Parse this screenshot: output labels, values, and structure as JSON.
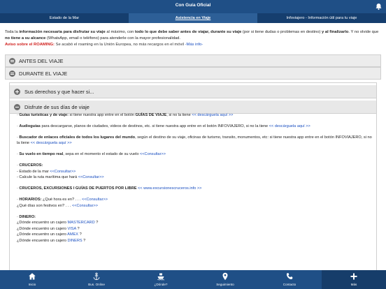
{
  "app": {
    "title": "Con Guía Oficial"
  },
  "tabs": [
    {
      "label": "Estado de la Mar"
    },
    {
      "label": "Asistencia en Viaje"
    },
    {
      "label": "Infoviajero - Información útil para tu viaje"
    }
  ],
  "intro": {
    "t1": "Toda la ",
    "b1": "información necesaria para disfrutar su viaje",
    "t2": " al máximo, con ",
    "b2": "todo lo que debe saber antes de viajar, durante su viaje",
    "t3": " (por si tiene dudas o problemas en destino) ",
    "b3": "y al finalizarlo",
    "t4": ". Y no olvide que ",
    "b4": "no tiene a su alcance",
    "t5": " (WhatsApp, email o teléfono) para atenderle con la mayor profesionalidad."
  },
  "roaming": {
    "label": "Aviso sobre el ROAMING:",
    "text": " Se acabó el roaming en la Unión Europea, no más recargos en el móvil ",
    "link": "-Más info-"
  },
  "accordions": {
    "antes": "ANTES DEL VIAJE",
    "durante": "DURANTE EL VIAJE"
  },
  "inner": {
    "derechos": "Sus derechos y que hacer si...",
    "disfrute": "Disfrute de sus días de viaje"
  },
  "items": {
    "guias_b": "Guías turísticas y de viaje:",
    "guias_t": " si tiene nuestra app entre en el botón ",
    "guias_b2": "GUÍAS DE VIAJE",
    "guias_t2": ", si no la tiene ",
    "guias_l": "<< descárguela aquí >>",
    "audio_b": "Audioguías",
    "audio_t": " para descargarse, planos de ciudades, videos de destinos, etc. si tiene nuestra app entre en el botón INFOVIAJERO, si no la tiene ",
    "audio_l": "<< descárguela aquí >>",
    "busc_b": "Buscador de enlaces oficiales de todos los lugares del mundo",
    "busc_t": ", según el destino de su viaje, oficinas de turismo, transito, monumentos, etc: si tiene nuestra app entre en el botón INFOVIAJERO, si no la tiene ",
    "busc_l": "<< descárguela aquí >>",
    "vuelo_b": "Su vuelo en tiempo real",
    "vuelo_t": ", sepa en el momento el estado de su vuelo ",
    "vuelo_l": "<<Consultar>>",
    "cruc_b": "CRUCEROS:",
    "cruc_1t": "- Estado de la mar ",
    "cruc_1l": "<<Consultar>>",
    "cruc_2t": "- Calcule la ruta marítima que hará ",
    "cruc_2l": "<<Consultar>>",
    "exc_b": "CRUCEROS, EXCURSIONES I GUÍAS DE PUERTOS POR LIBRE",
    "exc_l": "<< www.excursionescruceros.info >>",
    "hor_b": "HORARIOS:",
    "hor_1t": " ¿Qué hora es en? . . . ",
    "hor_1l": "<<Consultar>>",
    "hor_2t": "¿Qué días son festivos en? . . . ",
    "hor_2l": "<<Consultar>>",
    "din_b": "DINERO:",
    "din_pre": "¿Dónde encuentro un cajero ",
    "din_mc": "MASTERCARD",
    "din_visa": "VISA",
    "din_amex": "AMEX",
    "din_diners": "DINERS",
    "din_q": " ?"
  },
  "bottom_nav": [
    {
      "label": "Inicio",
      "icon": "home-icon"
    },
    {
      "label": "Bus. Online",
      "icon": "anchor-icon"
    },
    {
      "label": "¿Dónde?",
      "icon": "ship-icon"
    },
    {
      "label": "Seguimiento",
      "icon": "location-pin-icon"
    },
    {
      "label": "Contacto",
      "icon": "phone-icon"
    },
    {
      "label": "Más",
      "icon": "plus-icon"
    }
  ],
  "colors": {
    "header": "#1f4f86",
    "tabs": "#153e6e",
    "link": "#1a4fc0",
    "alert": "#d0201e"
  }
}
